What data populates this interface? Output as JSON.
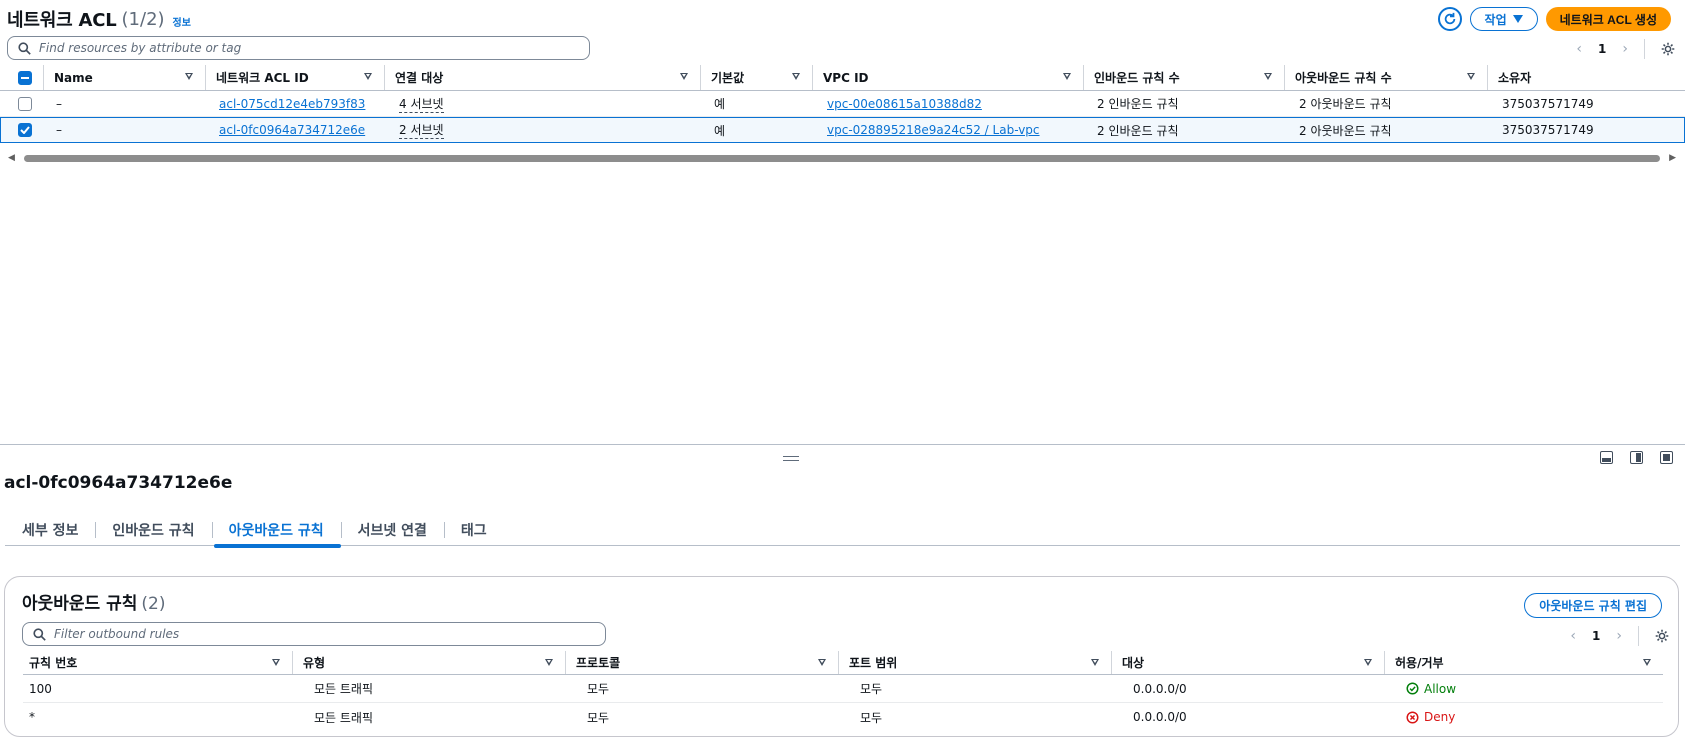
{
  "header": {
    "title": "네트워크 ACL",
    "count": "(1/2)",
    "info": "정보",
    "actions_label": "작업",
    "create_label": "네트워크 ACL 생성"
  },
  "search": {
    "placeholder": "Find resources by attribute or tag"
  },
  "pager": {
    "page": "1"
  },
  "acl_table": {
    "columns": [
      "Name",
      "네트워크 ACL ID",
      "연결 대상",
      "기본값",
      "VPC ID",
      "인바운드 규칙 수",
      "아웃바운드 규칙 수",
      "소유자"
    ],
    "rows": [
      {
        "selected": false,
        "name": "–",
        "acl_id": "acl-075cd12e4eb793f83",
        "assoc": "4 서브넷",
        "default": "예",
        "vpc": "vpc-00e08615a10388d82",
        "inbound": "2 인바운드 규칙",
        "outbound": "2 아웃바운드 규칙",
        "owner": "375037571749"
      },
      {
        "selected": true,
        "name": "–",
        "acl_id": "acl-0fc0964a734712e6e",
        "assoc": "2 서브넷",
        "default": "예",
        "vpc": "vpc-028895218e9a24c52 / Lab-vpc",
        "inbound": "2 인바운드 규칙",
        "outbound": "2 아웃바운드 규칙",
        "owner": "375037571749"
      }
    ]
  },
  "detail": {
    "title": "acl-0fc0964a734712e6e",
    "tabs": [
      "세부 정보",
      "인바운드 규칙",
      "아웃바운드 규칙",
      "서브넷 연결",
      "태그"
    ],
    "active_tab": "아웃바운드 규칙"
  },
  "outbound": {
    "title": "아웃바운드 규칙",
    "count": "(2)",
    "edit_label": "아웃바운드 규칙 편집",
    "filter_placeholder": "Filter outbound rules",
    "page": "1",
    "columns": [
      "규칙 번호",
      "유형",
      "프로토콜",
      "포트 범위",
      "대상",
      "허용/거부"
    ],
    "rows": [
      {
        "rule": "100",
        "type": "모든 트래픽",
        "protocol": "모두",
        "port": "모두",
        "dest": "0.0.0.0/0",
        "action": "Allow"
      },
      {
        "rule": "*",
        "type": "모든 트래픽",
        "protocol": "모두",
        "port": "모두",
        "dest": "0.0.0.0/0",
        "action": "Deny"
      }
    ]
  },
  "colors": {
    "link": "#0972d3",
    "primary": "#ff9900",
    "allow": "#037f0c",
    "deny": "#d91515"
  }
}
